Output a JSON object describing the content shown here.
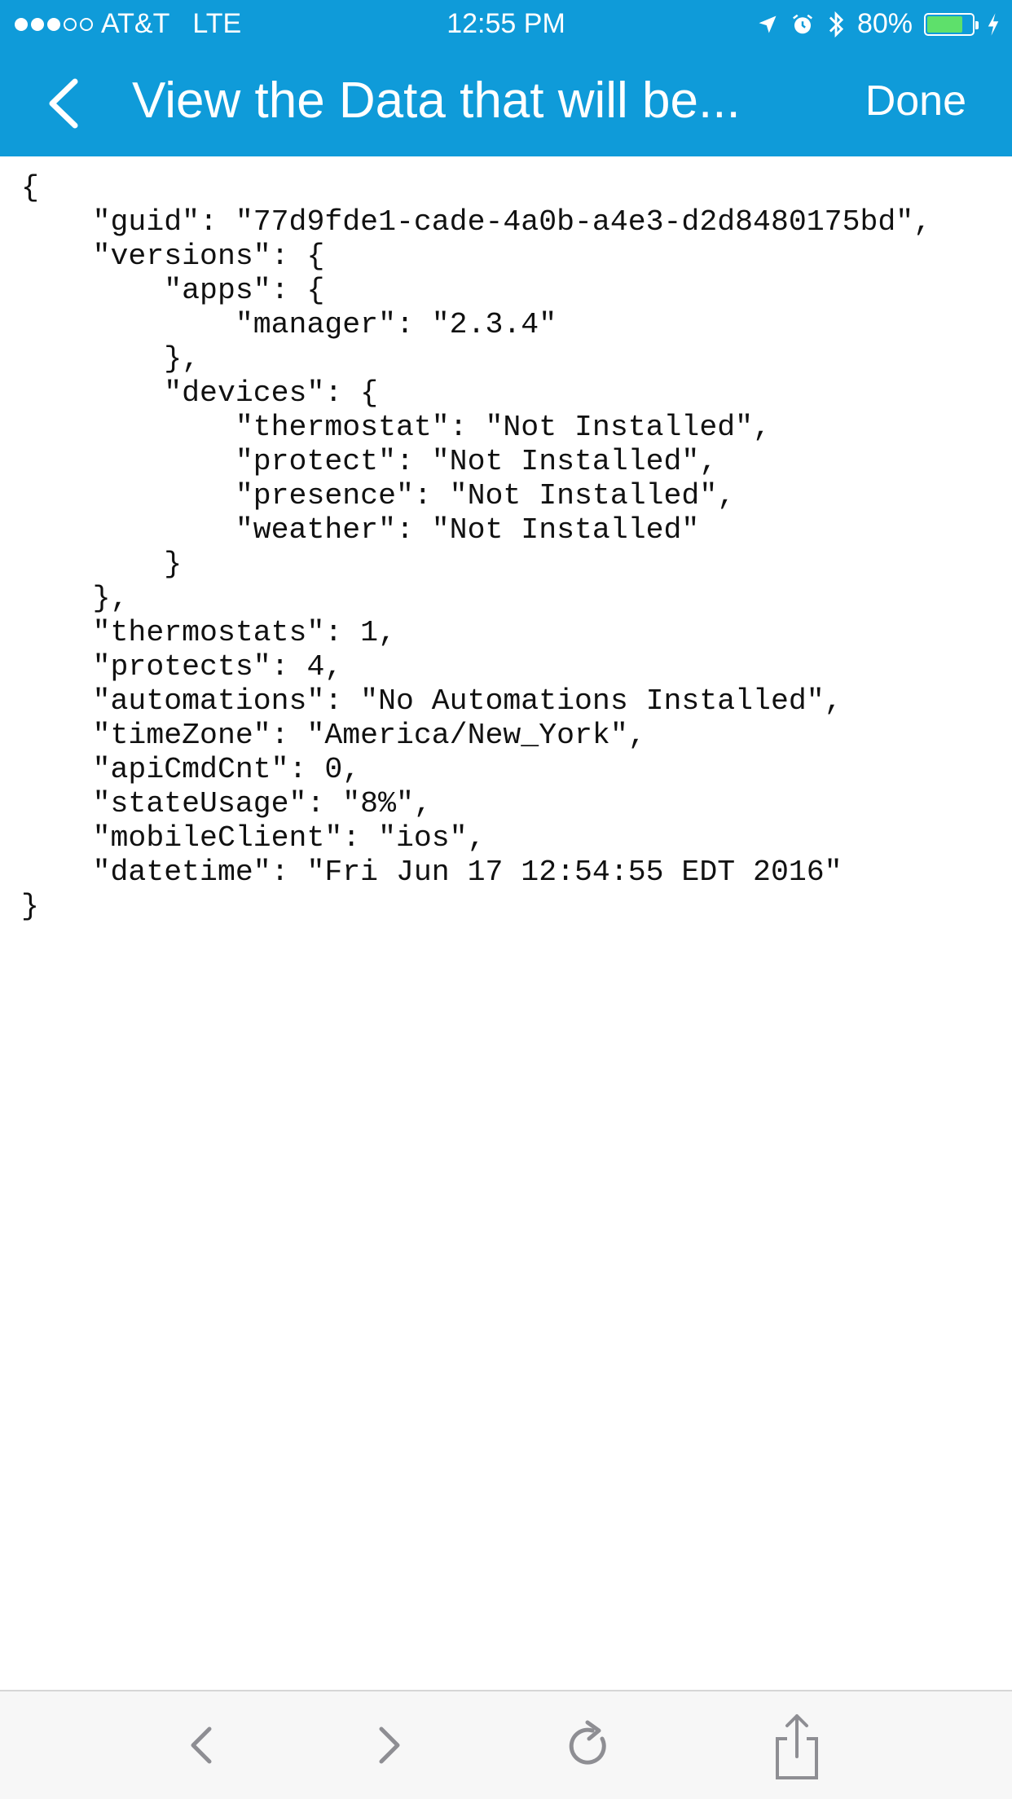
{
  "status_bar": {
    "carrier": "AT&T",
    "network": "LTE",
    "time": "12:55 PM",
    "battery": "80%",
    "battery_level": 0.8
  },
  "nav": {
    "title": "View the Data that will be...",
    "done_label": "Done"
  },
  "content": {
    "json_text": "{\n    \"guid\": \"77d9fde1-cade-4a0b-a4e3-d2d8480175bd\",\n    \"versions\": {\n        \"apps\": {\n            \"manager\": \"2.3.4\"\n        },\n        \"devices\": {\n            \"thermostat\": \"Not Installed\",\n            \"protect\": \"Not Installed\",\n            \"presence\": \"Not Installed\",\n            \"weather\": \"Not Installed\"\n        }\n    },\n    \"thermostats\": 1,\n    \"protects\": 4,\n    \"automations\": \"No Automations Installed\",\n    \"timeZone\": \"America/New_York\",\n    \"apiCmdCnt\": 0,\n    \"stateUsage\": \"8%\",\n    \"mobileClient\": \"ios\",\n    \"datetime\": \"Fri Jun 17 12:54:55 EDT 2016\"\n}"
  },
  "toolbar": {
    "icons": [
      "back-arrow-icon",
      "forward-arrow-icon",
      "reload-icon",
      "share-icon"
    ]
  },
  "colors": {
    "header": "#0f9bd9",
    "battery_fill": "#5ee06b"
  }
}
